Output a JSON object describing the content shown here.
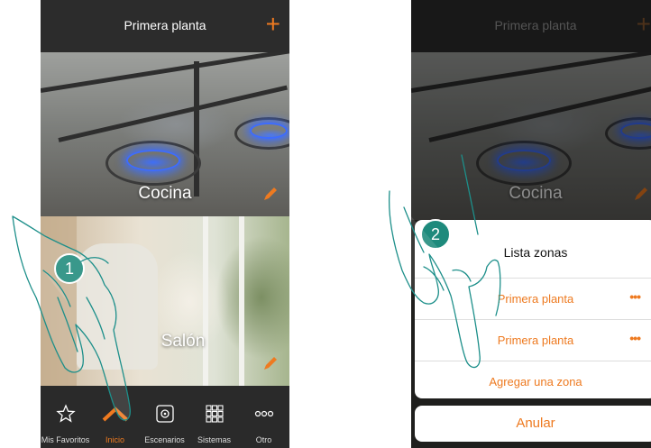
{
  "left_screen": {
    "title": "Primera planta",
    "add_label": "+",
    "rooms": [
      {
        "name": "Cocina"
      },
      {
        "name": "Salón"
      }
    ],
    "step": "1",
    "nav": [
      {
        "label": "Mis Favoritos",
        "icon": "star-icon",
        "active": false
      },
      {
        "label": "Inicio",
        "icon": "home-icon",
        "active": true
      },
      {
        "label": "Escenarios",
        "icon": "scenarios-icon",
        "active": false
      },
      {
        "label": "Sistemas",
        "icon": "grid-icon",
        "active": false
      },
      {
        "label": "Otro",
        "icon": "more-icon",
        "active": false
      }
    ]
  },
  "right_screen": {
    "title": "Primera planta",
    "add_label": "+",
    "room": "Cocina",
    "step": "2",
    "sheet": {
      "title": "Lista zonas",
      "rows": [
        "Primera planta",
        "Primera planta"
      ],
      "more_label": "•••",
      "add_zone": "Agregar una zona"
    },
    "cancel": "Anular"
  },
  "colors": {
    "accent": "#ee7a20",
    "bar": "#2c2c2c",
    "step_badge": "#1e8a7c",
    "hand_outline": "#1d8f8a"
  }
}
